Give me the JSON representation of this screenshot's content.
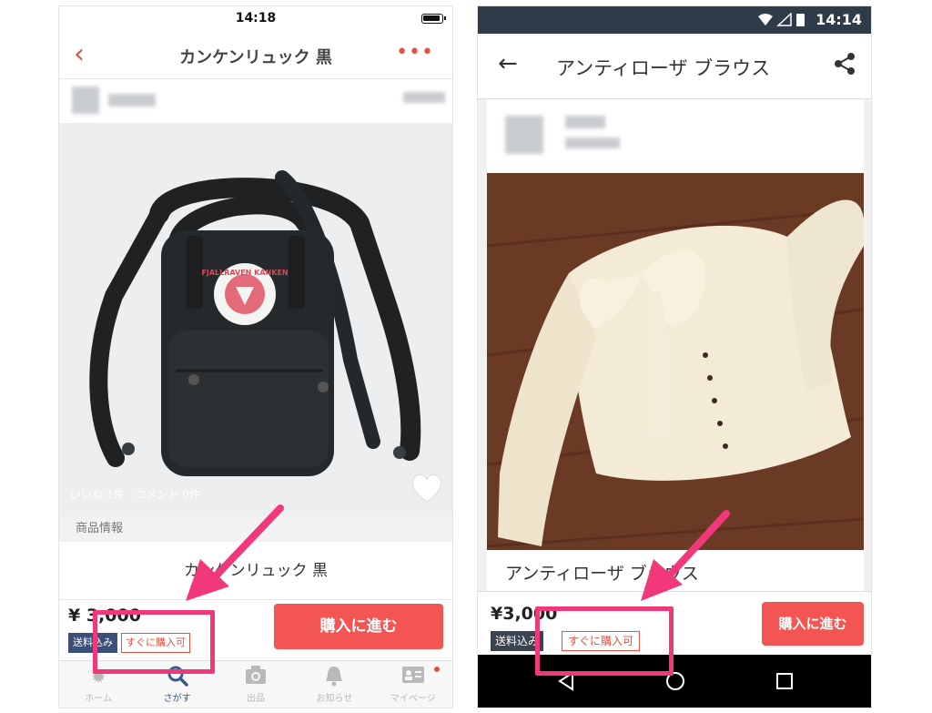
{
  "ios": {
    "status_time": "14:18",
    "title": "カンケンリュック 黒",
    "stats": "いいね 1件　コメント 0件",
    "section_label": "商品情報",
    "product_name": "カンケンリュック 黒",
    "price": "¥ 3,000",
    "tag_shipping": "送料込み",
    "tag_instant": "すぐに購入可",
    "buy_label": "購入に進む",
    "badge_text": "FJALLRAVEN KANKEN",
    "tabs": [
      {
        "label": "ホーム",
        "icon": "home-icon"
      },
      {
        "label": "さがす",
        "icon": "search-icon"
      },
      {
        "label": "出品",
        "icon": "camera-icon"
      },
      {
        "label": "お知らせ",
        "icon": "bell-icon"
      },
      {
        "label": "マイページ",
        "icon": "profile-card-icon"
      }
    ]
  },
  "android": {
    "status_time": "14:14",
    "title": "アンティローザ ブラウス",
    "product_name": "アンティローザ ブラウス",
    "price": "¥3,000",
    "tag_shipping": "送料込み",
    "tag_instant": "すぐに購入可",
    "buy_label": "購入に進む"
  },
  "colors": {
    "accent": "#f25552",
    "highlight": "#f0387a",
    "tag_navy": "#3b4f7a",
    "status_bar": "#2e3b48"
  }
}
